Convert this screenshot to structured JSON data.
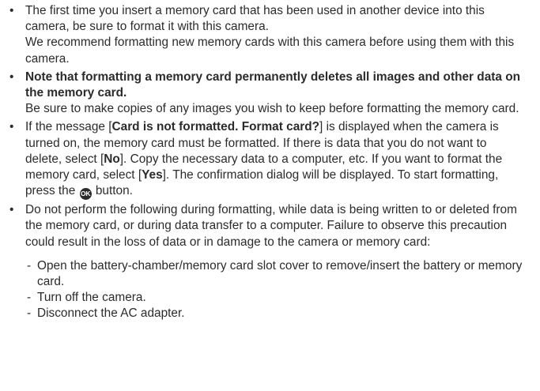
{
  "bullets": [
    {
      "symbol": "•",
      "p1": "The first time you insert a memory card that has been used in another device into this camera, be sure to format it with this camera.",
      "p2": "We recommend formatting new memory cards with this camera before using them with this camera."
    },
    {
      "symbol": "•",
      "bold": "Note that formatting a memory card permanently deletes all images and other data on the memory card.",
      "p2": "Be sure to make copies of any images you wish to keep before formatting the memory card."
    },
    {
      "symbol": "•",
      "t1": "If the message [",
      "msg": "Card is not formatted. Format card?",
      "t2": "] is displayed when the camera is turned on, the memory card must be formatted. If there is data that you do not want to delete, select [",
      "no": "No",
      "t3": "]. Copy the necessary data to a computer, etc. If you want to format the memory card, select [",
      "yes": "Yes",
      "t4": "]. The confirmation dialog will be displayed. To start formatting, press the ",
      "ok_icon": "ok-button-icon",
      "ok_text": "OK",
      "t5": " button."
    },
    {
      "symbol": "•",
      "p1": "Do not perform the following during formatting, while data is being written to or deleted from the memory card, or during data transfer to a computer. Failure to observe this precaution could result in the loss of data or in damage to the camera or memory card:",
      "subitems": [
        {
          "dash": "-",
          "text": "Open the battery-chamber/memory card slot cover to remove/insert the battery or memory card."
        },
        {
          "dash": "-",
          "text": "Turn off the camera."
        },
        {
          "dash": "-",
          "text": "Disconnect the AC adapter."
        }
      ]
    }
  ]
}
